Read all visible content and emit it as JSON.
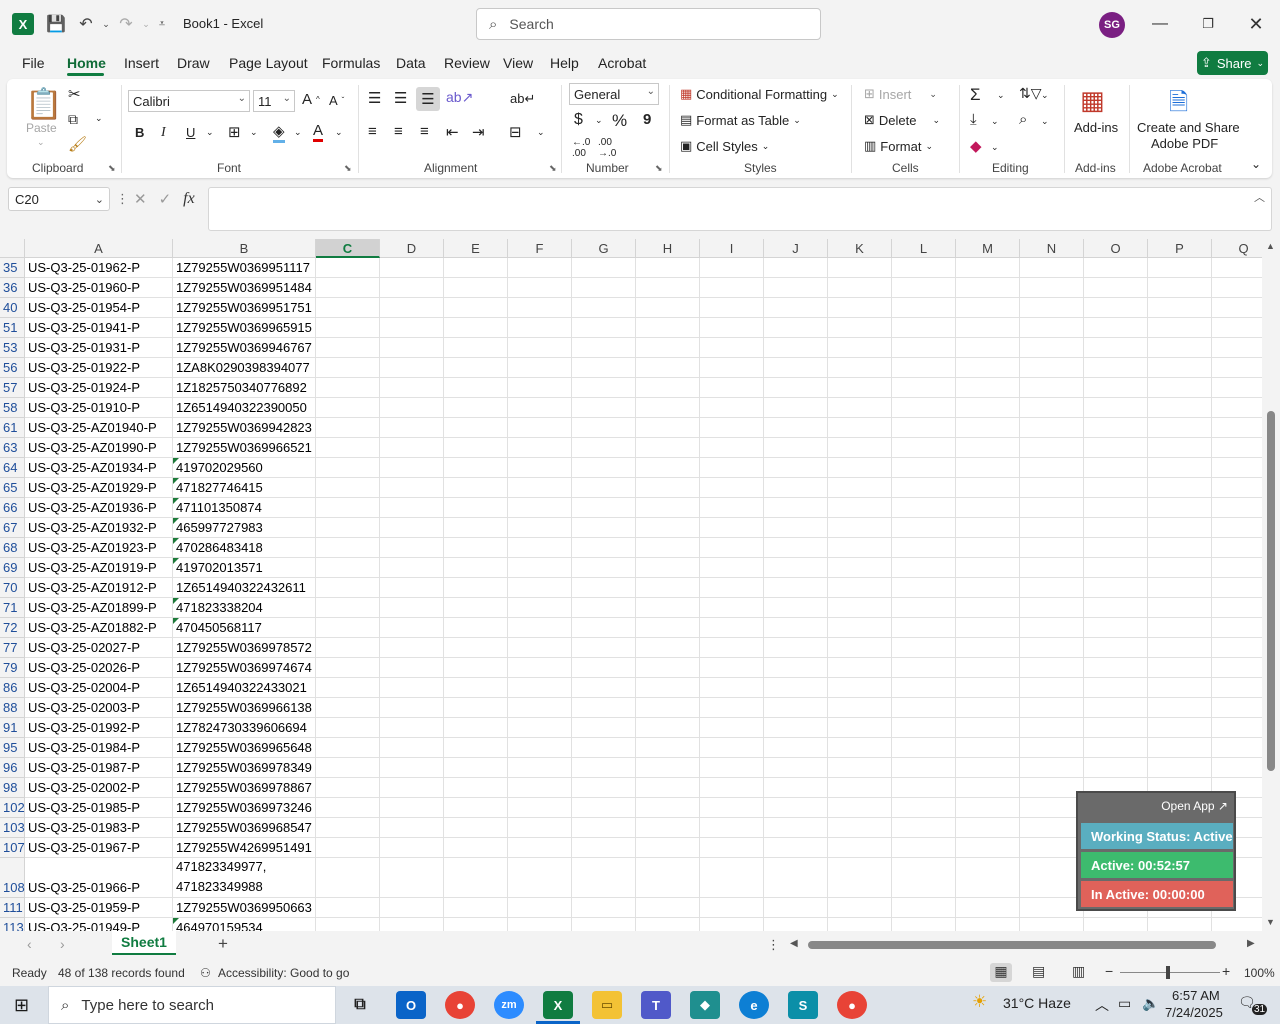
{
  "titlebar": {
    "app_logo": "X",
    "doc_title": "Book1  -  Excel",
    "search_placeholder": "Search",
    "avatar_initials": "SG"
  },
  "menu": {
    "tabs": [
      "File",
      "Home",
      "Insert",
      "Draw",
      "Page Layout",
      "Formulas",
      "Data",
      "Review",
      "View",
      "Help",
      "Acrobat"
    ],
    "active": "Home",
    "share_label": "Share"
  },
  "ribbon": {
    "clipboard": {
      "paste": "Paste",
      "group": "Clipboard"
    },
    "font": {
      "name": "Calibri",
      "size": "11",
      "group": "Font",
      "bold": "B",
      "italic": "I",
      "underline": "U"
    },
    "alignment": {
      "group": "Alignment"
    },
    "number": {
      "format": "General",
      "group": "Number",
      "currency": "$",
      "percent": "%",
      "comma": "9"
    },
    "styles": {
      "conditional": "Conditional Formatting",
      "format_table": "Format as Table",
      "cell_styles": "Cell Styles",
      "group": "Styles"
    },
    "cells": {
      "insert": "Insert",
      "delete": "Delete",
      "format": "Format",
      "group": "Cells"
    },
    "editing": {
      "group": "Editing"
    },
    "addins": {
      "label": "Add-ins",
      "group": "Add-ins"
    },
    "acrobat": {
      "label_line1": "Create and Share",
      "label_line2": "Adobe PDF",
      "group": "Adobe Acrobat"
    }
  },
  "formula_bar": {
    "name_box": "C20",
    "fx": "fx",
    "value": ""
  },
  "grid": {
    "columns": [
      "A",
      "B",
      "C",
      "D",
      "E",
      "F",
      "G",
      "H",
      "I",
      "J",
      "K",
      "L",
      "M",
      "N",
      "O",
      "P",
      "Q"
    ],
    "selected_column": "C",
    "rows": [
      {
        "num": "35",
        "a": "US-Q3-25-01962-P",
        "b": "1Z79255W0369951117",
        "tri": false
      },
      {
        "num": "36",
        "a": "US-Q3-25-01960-P",
        "b": "1Z79255W0369951484",
        "tri": false
      },
      {
        "num": "40",
        "a": "US-Q3-25-01954-P",
        "b": "1Z79255W0369951751",
        "tri": false
      },
      {
        "num": "51",
        "a": "US-Q3-25-01941-P",
        "b": "1Z79255W0369965915",
        "tri": false
      },
      {
        "num": "53",
        "a": "US-Q3-25-01931-P",
        "b": "1Z79255W0369946767",
        "tri": false
      },
      {
        "num": "56",
        "a": "US-Q3-25-01922-P",
        "b": "1ZA8K0290398394077",
        "tri": false
      },
      {
        "num": "57",
        "a": "US-Q3-25-01924-P",
        "b": "1Z1825750340776892",
        "tri": false
      },
      {
        "num": "58",
        "a": "US-Q3-25-01910-P",
        "b": "1Z6514940322390050",
        "tri": false
      },
      {
        "num": "61",
        "a": "US-Q3-25-AZ01940-P",
        "b": "1Z79255W0369942823",
        "tri": false
      },
      {
        "num": "63",
        "a": "US-Q3-25-AZ01990-P",
        "b": "1Z79255W0369966521",
        "tri": false
      },
      {
        "num": "64",
        "a": "US-Q3-25-AZ01934-P",
        "b": "419702029560",
        "tri": true
      },
      {
        "num": "65",
        "a": "US-Q3-25-AZ01929-P",
        "b": "471827746415",
        "tri": true
      },
      {
        "num": "66",
        "a": "US-Q3-25-AZ01936-P",
        "b": "471101350874",
        "tri": true
      },
      {
        "num": "67",
        "a": "US-Q3-25-AZ01932-P",
        "b": "465997727983",
        "tri": true
      },
      {
        "num": "68",
        "a": "US-Q3-25-AZ01923-P",
        "b": "470286483418",
        "tri": true
      },
      {
        "num": "69",
        "a": "US-Q3-25-AZ01919-P",
        "b": "419702013571",
        "tri": true
      },
      {
        "num": "70",
        "a": "US-Q3-25-AZ01912-P",
        "b": "1Z6514940322432611",
        "tri": false
      },
      {
        "num": "71",
        "a": "US-Q3-25-AZ01899-P",
        "b": "471823338204",
        "tri": true
      },
      {
        "num": "72",
        "a": "US-Q3-25-AZ01882-P",
        "b": "470450568117",
        "tri": true
      },
      {
        "num": "77",
        "a": "US-Q3-25-02027-P",
        "b": "1Z79255W0369978572",
        "tri": false
      },
      {
        "num": "79",
        "a": "US-Q3-25-02026-P",
        "b": "1Z79255W0369974674",
        "tri": false
      },
      {
        "num": "86",
        "a": "US-Q3-25-02004-P",
        "b": "1Z6514940322433021",
        "tri": false
      },
      {
        "num": "88",
        "a": "US-Q3-25-02003-P",
        "b": "1Z79255W0369966138",
        "tri": false
      },
      {
        "num": "91",
        "a": "US-Q3-25-01992-P",
        "b": "1Z7824730339606694",
        "tri": false
      },
      {
        "num": "95",
        "a": "US-Q3-25-01984-P",
        "b": "1Z79255W0369965648",
        "tri": false
      },
      {
        "num": "96",
        "a": "US-Q3-25-01987-P",
        "b": "1Z79255W0369978349",
        "tri": false
      },
      {
        "num": "98",
        "a": "US-Q3-25-02002-P",
        "b": "1Z79255W0369978867",
        "tri": false
      },
      {
        "num": "102",
        "a": "US-Q3-25-01985-P",
        "b": "1Z79255W0369973246",
        "tri": false
      },
      {
        "num": "103",
        "a": "US-Q3-25-01983-P",
        "b": "1Z79255W0369968547",
        "tri": false
      },
      {
        "num": "107",
        "a": "US-Q3-25-01967-P",
        "b": "1Z79255W4269951491",
        "tri": false
      },
      {
        "num": "108",
        "a": "US-Q3-25-01966-P",
        "b": "471823349977,\n471823349988",
        "tri": false,
        "tall": true
      },
      {
        "num": "111",
        "a": "US-Q3-25-01959-P",
        "b": "1Z79255W0369950663",
        "tri": false
      },
      {
        "num": "113",
        "a": "US-Q3-25-01949-P",
        "b": "464970159534",
        "tri": true
      }
    ]
  },
  "sheets": {
    "active": "Sheet1",
    "add": "+"
  },
  "status": {
    "ready": "Ready",
    "records": "48 of 138 records found",
    "accessibility": "Accessibility: Good to go",
    "zoom": "100%"
  },
  "widget": {
    "open_app": "Open App ↗",
    "working": "Working Status: Active",
    "active": "Active: 00:52:57",
    "inactive": "In Active: 00:00:00",
    "colors": {
      "working": "#5aaec0",
      "active": "#3dbb6e",
      "inactive": "#e0625a"
    }
  },
  "taskbar": {
    "search_placeholder": "Type here to search",
    "weather": "31°C  Haze",
    "time": "6:57 AM",
    "date": "7/24/2025",
    "notifications": "31"
  },
  "colors": {
    "excel_green": "#107c41",
    "accent": "#0f6b37"
  }
}
